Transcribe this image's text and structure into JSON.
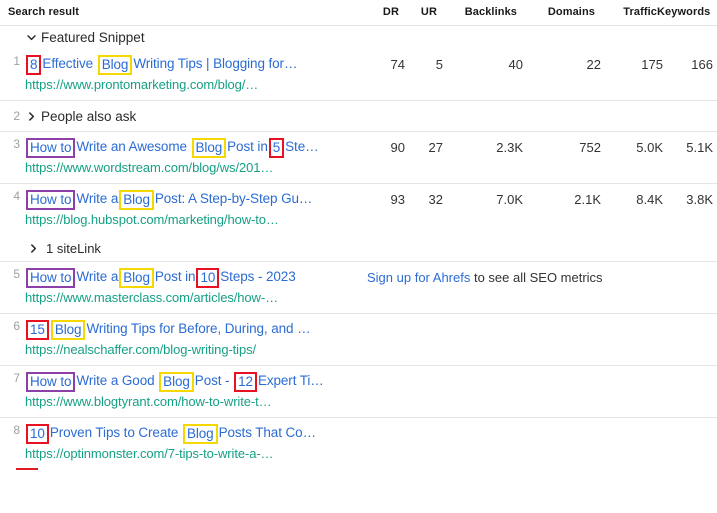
{
  "colors": {
    "link": "#2b6cd4",
    "url": "#16a085",
    "highlight_red": "#e81123",
    "highlight_yellow": "#f5d800",
    "highlight_purple": "#8e3fa8",
    "divider": "#e6e6e6",
    "index": "#a0a0a0"
  },
  "header": {
    "search_result": "Search result",
    "columns": [
      {
        "key": "dr",
        "label": "DR"
      },
      {
        "key": "ur",
        "label": "UR"
      },
      {
        "key": "backlinks",
        "label": "Backlinks"
      },
      {
        "key": "domains",
        "label": "Domains"
      },
      {
        "key": "traffic",
        "label": "Traffic"
      },
      {
        "key": "keywords",
        "label": "Keywords"
      }
    ]
  },
  "groups": {
    "featured_snippet": {
      "label": "Featured Snippet",
      "chevron": "chevron-down-icon",
      "expanded": true
    },
    "people_also_ask": {
      "index": "2",
      "label": "People also ask",
      "chevron": "chevron-right-icon",
      "expanded": false
    },
    "sitelink": {
      "label": "1 siteLink",
      "chevron": "chevron-right-icon",
      "expanded": false
    }
  },
  "cta": {
    "link_text": "Sign up for Ahrefs",
    "rest_text": " to see all SEO metrics"
  },
  "rows": [
    {
      "index": "1",
      "title_parts": [
        {
          "text": "8",
          "highlight": "red"
        },
        {
          "text": "Effective ",
          "highlight": null
        },
        {
          "text": "Blog",
          "highlight": "yellow"
        },
        {
          "text": "Writing Tips | Blogging for…",
          "highlight": null
        }
      ],
      "url": "https://www.prontomarketing.com/blog/…",
      "metrics": {
        "dr": "74",
        "ur": "5",
        "backlinks": "40",
        "domains": "22",
        "traffic": "175",
        "keywords": "166"
      }
    },
    {
      "index": "3",
      "title_parts": [
        {
          "text": "How to",
          "highlight": "purple"
        },
        {
          "text": "Write an Awesome ",
          "highlight": null
        },
        {
          "text": "Blog",
          "highlight": "yellow"
        },
        {
          "text": "Post in",
          "highlight": null
        },
        {
          "text": "5",
          "highlight": "red"
        },
        {
          "text": "Ste…",
          "highlight": null
        }
      ],
      "url": "https://www.wordstream.com/blog/ws/201…",
      "metrics": {
        "dr": "90",
        "ur": "27",
        "backlinks": "2.3K",
        "domains": "752",
        "traffic": "5.0K",
        "keywords": "5.1K"
      }
    },
    {
      "index": "4",
      "title_parts": [
        {
          "text": "How to",
          "highlight": "purple"
        },
        {
          "text": "Write a",
          "highlight": null
        },
        {
          "text": "Blog",
          "highlight": "yellow"
        },
        {
          "text": "Post: A Step-by-Step Gu…",
          "highlight": null
        }
      ],
      "url": "https://blog.hubspot.com/marketing/how-to…",
      "metrics": {
        "dr": "93",
        "ur": "32",
        "backlinks": "7.0K",
        "domains": "2.1K",
        "traffic": "8.4K",
        "keywords": "3.8K"
      }
    },
    {
      "index": "5",
      "title_parts": [
        {
          "text": "How to",
          "highlight": "purple"
        },
        {
          "text": "Write a",
          "highlight": null
        },
        {
          "text": "Blog",
          "highlight": "yellow"
        },
        {
          "text": "Post in",
          "highlight": null
        },
        {
          "text": "10",
          "highlight": "red"
        },
        {
          "text": "Steps - 2023",
          "highlight": null
        }
      ],
      "url": "https://www.masterclass.com/articles/how-…",
      "metrics": null,
      "cta": true
    },
    {
      "index": "6",
      "title_parts": [
        {
          "text": "15",
          "highlight": "red"
        },
        {
          "text": "Blog",
          "highlight": "yellow"
        },
        {
          "text": "Writing Tips for Before, During, and …",
          "highlight": null
        }
      ],
      "url": "https://nealschaffer.com/blog-writing-tips/",
      "metrics": null
    },
    {
      "index": "7",
      "title_parts": [
        {
          "text": "How to",
          "highlight": "purple"
        },
        {
          "text": "Write a Good ",
          "highlight": null
        },
        {
          "text": "Blog",
          "highlight": "yellow"
        },
        {
          "text": "Post - ",
          "highlight": null
        },
        {
          "text": "12",
          "highlight": "red"
        },
        {
          "text": "Expert Ti…",
          "highlight": null
        }
      ],
      "url": "https://www.blogtyrant.com/how-to-write-t…",
      "metrics": null
    },
    {
      "index": "8",
      "title_parts": [
        {
          "text": "10",
          "highlight": "red"
        },
        {
          "text": "Proven Tips to Create ",
          "highlight": null
        },
        {
          "text": "Blog",
          "highlight": "yellow"
        },
        {
          "text": "Posts That Co…",
          "highlight": null
        }
      ],
      "url": "https://optinmonster.com/7-tips-to-write-a-…",
      "metrics": null
    }
  ]
}
